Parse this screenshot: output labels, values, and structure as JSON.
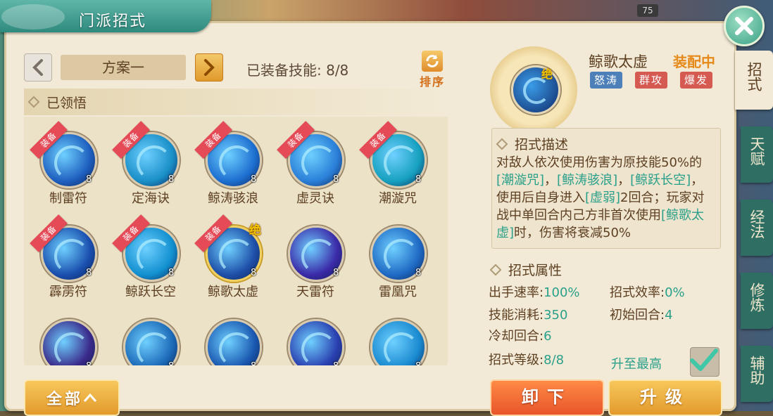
{
  "title": "门派招式",
  "hud_number": "75",
  "scheme": {
    "name": "方案一",
    "equipped_label": "已装备技能: 8/8"
  },
  "sort_label": "排序",
  "section_learned": "已领悟",
  "equip_tag": "装备",
  "jue_tag": "绝",
  "skills": [
    {
      "name": "制雷符",
      "level": "8",
      "equipped": true,
      "color": "#1e5fbf"
    },
    {
      "name": "定海诀",
      "level": "8",
      "equipped": true,
      "color": "#1a8fc8"
    },
    {
      "name": "鲸涛骇浪",
      "level": "8",
      "equipped": true,
      "color": "#1d6fd0"
    },
    {
      "name": "虚灵诀",
      "level": "8",
      "equipped": true,
      "color": "#2a7fd8"
    },
    {
      "name": "潮漩咒",
      "level": "8",
      "equipped": true,
      "color": "#16a0c0"
    },
    {
      "name": "霹雳符",
      "level": "8",
      "equipped": true,
      "color": "#1a4fae"
    },
    {
      "name": "鲸跃长空",
      "level": "8",
      "equipped": true,
      "color": "#1290d0"
    },
    {
      "name": "鲸歌太虚",
      "level": "8",
      "equipped": true,
      "color": "#1e4fa8"
    },
    {
      "name": "天雷符",
      "level": "8",
      "equipped": false,
      "color": "#3b2aa8"
    },
    {
      "name": "雷凰咒",
      "level": "8",
      "equipped": false,
      "color": "#1f6ac4"
    },
    {
      "name": "",
      "level": "8",
      "equipped": false,
      "color": "#3a2a8a"
    },
    {
      "name": "",
      "level": "8",
      "equipped": false,
      "color": "#1c6ab8"
    },
    {
      "name": "",
      "level": "8",
      "equipped": false,
      "color": "#1a58b0"
    },
    {
      "name": "",
      "level": "8",
      "equipped": false,
      "color": "#2a40b0"
    },
    {
      "name": "",
      "level": "8",
      "equipped": false,
      "color": "#1a8ad0"
    }
  ],
  "all_button": "全部",
  "selected": {
    "name": "鲸歌太虚",
    "status": "装配中",
    "tags": [
      "怒涛",
      "群攻",
      "爆发"
    ],
    "desc_title": "招式描述",
    "desc_parts": [
      {
        "t": "对敌人依次使用伤害为原技能50%的",
        "hl": false
      },
      {
        "t": "[潮漩咒]",
        "hl": true
      },
      {
        "t": "，",
        "hl": false
      },
      {
        "t": "[鲸涛骇浪]",
        "hl": true
      },
      {
        "t": "，",
        "hl": false
      },
      {
        "t": "[鲸跃长空]",
        "hl": true
      },
      {
        "t": "，使用后自身进入",
        "hl": false
      },
      {
        "t": "[虚弱]",
        "hl": true
      },
      {
        "t": "2回合；玩家对战中单回合内己方非首次使用",
        "hl": false
      },
      {
        "t": "[鲸歌太虚]",
        "hl": true
      },
      {
        "t": "时，伤害将衰减50%",
        "hl": false
      }
    ],
    "attr_title": "招式属性",
    "attrs": {
      "speed_label": "出手速率:",
      "speed_value": "100%",
      "efficiency_label": "招式效率:",
      "efficiency_value": "0%",
      "cost_label": "技能消耗:",
      "cost_value": "350",
      "init_label": "初始回合:",
      "init_value": "4",
      "cooldown_label": "冷却回合:",
      "cooldown_value": "6",
      "level_label": "招式等级:",
      "level_value": "8/8"
    },
    "maxed_label": "升至最高"
  },
  "buttons": {
    "unequip": "卸下",
    "upgrade": "升级"
  },
  "side_tabs": [
    "招式",
    "天赋",
    "经法",
    "修炼",
    "辅助"
  ]
}
